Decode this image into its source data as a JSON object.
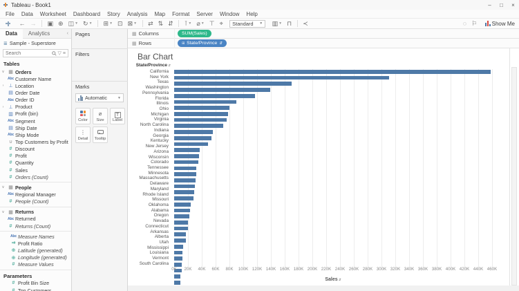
{
  "window": {
    "title": "Tableau - Book1",
    "controls": {
      "minimize": "–",
      "maximize": "□",
      "close": "×"
    }
  },
  "menu": {
    "items": [
      "File",
      "Data",
      "Worksheet",
      "Dashboard",
      "Story",
      "Analysis",
      "Map",
      "Format",
      "Server",
      "Window",
      "Help"
    ]
  },
  "toolbar": {
    "left_icons": [
      {
        "name": "undo-icon",
        "glyph": "←"
      },
      {
        "name": "redo-icon",
        "glyph": "→",
        "disabled": true
      },
      {
        "sep": true
      },
      {
        "name": "save-icon",
        "glyph": "▣"
      },
      {
        "name": "add-data-icon",
        "glyph": "⊕"
      },
      {
        "name": "pause-updates-icon",
        "glyph": "◫",
        "caret": true
      },
      {
        "name": "run-update-icon",
        "glyph": "↻",
        "caret": true
      },
      {
        "sep": true
      },
      {
        "name": "new-worksheet-icon",
        "glyph": "⊞",
        "caret": true
      },
      {
        "name": "duplicate-sheet-icon",
        "glyph": "⊡"
      },
      {
        "name": "clear-sheet-icon",
        "glyph": "⊠",
        "caret": true
      },
      {
        "sep": true
      },
      {
        "name": "swap-axes-icon",
        "glyph": "⇄"
      },
      {
        "name": "sort-ascending-icon",
        "glyph": "⇅"
      },
      {
        "name": "sort-descending-icon",
        "glyph": "⇵"
      },
      {
        "sep": true
      },
      {
        "name": "mark-labels-icon",
        "glyph": "⊺",
        "caret": true
      },
      {
        "name": "fix-axes-icon",
        "glyph": "⌀",
        "caret": true
      },
      {
        "name": "text-table-icon",
        "glyph": "⊤"
      },
      {
        "name": "drop-lines-icon",
        "glyph": "⌖"
      }
    ],
    "fit_label": "Standard",
    "after_fit_icons": [
      {
        "name": "show-cards-icon",
        "glyph": "▥",
        "caret": true
      },
      {
        "name": "presentation-mode-icon",
        "glyph": "⊓"
      },
      {
        "sep": true
      },
      {
        "name": "share-icon",
        "glyph": "≺"
      }
    ],
    "right_icons": [
      {
        "name": "data-details-icon",
        "glyph": "◌"
      },
      {
        "name": "flag-icon",
        "glyph": "⚐"
      }
    ],
    "show_me_label": "Show Me"
  },
  "data_pane": {
    "tabs": [
      {
        "label": "Data",
        "active": true
      },
      {
        "label": "Analytics",
        "active": false
      }
    ],
    "collapse_glyph": "‹",
    "datasource": "Sample - Superstore",
    "search": {
      "placeholder": "Search"
    },
    "tables_header": "Tables",
    "parameters_header": "Parameters",
    "items": [
      {
        "label": "Orders",
        "icon": "table",
        "header": true,
        "expanded": true
      },
      {
        "label": "Customer Name",
        "icon": "abc"
      },
      {
        "label": "Location",
        "icon": "hierarchy",
        "expandable": true
      },
      {
        "label": "Order Date",
        "icon": "calendar"
      },
      {
        "label": "Order ID",
        "icon": "abc"
      },
      {
        "label": "Product",
        "icon": "hierarchy",
        "expandable": true
      },
      {
        "label": "Profit (bin)",
        "icon": "bin"
      },
      {
        "label": "Segment",
        "icon": "abc"
      },
      {
        "label": "Ship Date",
        "icon": "calendar"
      },
      {
        "label": "Ship Mode",
        "icon": "abc"
      },
      {
        "label": "Top Customers by Profit",
        "icon": "set"
      },
      {
        "label": "Discount",
        "icon": "measure"
      },
      {
        "label": "Profit",
        "icon": "measure"
      },
      {
        "label": "Quantity",
        "icon": "measure"
      },
      {
        "label": "Sales",
        "icon": "measure"
      },
      {
        "label": "Orders (Count)",
        "icon": "measure",
        "italic": true
      },
      {
        "divider": true
      },
      {
        "label": "People",
        "icon": "table",
        "header": true,
        "expanded": true
      },
      {
        "label": "Regional Manager",
        "icon": "abc"
      },
      {
        "label": "People (Count)",
        "icon": "measure",
        "italic": true
      },
      {
        "divider": true
      },
      {
        "label": "Returns",
        "icon": "table",
        "header": true,
        "expanded": true
      },
      {
        "label": "Returned",
        "icon": "abc"
      },
      {
        "label": "Returns (Count)",
        "icon": "measure",
        "italic": true
      },
      {
        "divider": true
      },
      {
        "label": "Measure Names",
        "icon": "abc",
        "italic": true,
        "loose": true
      },
      {
        "label": "Profit Ratio",
        "icon": "calc",
        "loose": true
      },
      {
        "label": "Latitude (generated)",
        "icon": "geo",
        "italic": true,
        "loose": true
      },
      {
        "label": "Longitude (generated)",
        "icon": "geo",
        "italic": true,
        "loose": true
      },
      {
        "label": "Measure Values",
        "icon": "measure",
        "italic": true,
        "loose": true
      },
      {
        "divider": true
      },
      {
        "param_header": true
      },
      {
        "label": "Profit Bin Size",
        "icon": "measure",
        "loose": true
      },
      {
        "label": "Top Customers",
        "icon": "measure",
        "loose": true
      }
    ]
  },
  "cards": {
    "pages_label": "Pages",
    "filters_label": "Filters",
    "marks_label": "Marks",
    "mark_type_label": "Automatic",
    "buttons": [
      {
        "label": "Color",
        "icon": "color-swatches"
      },
      {
        "label": "Size",
        "icon": "size"
      },
      {
        "label": "Label",
        "icon": "text-label"
      },
      {
        "label": "Detail",
        "icon": "detail"
      },
      {
        "label": "Tooltip",
        "icon": "tooltip"
      }
    ]
  },
  "shelves": {
    "columns_label": "Columns",
    "rows_label": "Rows",
    "columns_pills": [
      {
        "label": "SUM(Sales)",
        "type": "measure"
      }
    ],
    "rows_pills": [
      {
        "label": "State/Province",
        "type": "dimension",
        "sorted": true
      }
    ]
  },
  "sheet": {
    "title": "Bar Chart"
  },
  "chart_data": {
    "type": "bar",
    "orientation": "horizontal",
    "title": "Bar Chart",
    "row_header": "State/Province",
    "xlabel": "Sales",
    "value_unit": "USD, thousands (K)",
    "xlim": [
      0,
      460
    ],
    "tick_step_k": 20,
    "tick_labels": [
      "0K",
      "20K",
      "40K",
      "60K",
      "80K",
      "100K",
      "120K",
      "140K",
      "160K",
      "180K",
      "200K",
      "220K",
      "240K",
      "260K",
      "280K",
      "300K",
      "320K",
      "340K",
      "360K",
      "380K",
      "400K",
      "420K",
      "440K",
      "460K"
    ],
    "grid": true,
    "sort": "descending by SUM(Sales)",
    "bar_color": "#4e79a7",
    "categories": [
      "California",
      "New York",
      "Texas",
      "Washington",
      "Pennsylvania",
      "Florida",
      "Illinois",
      "Ohio",
      "Michigan",
      "Virginia",
      "North Carolina",
      "Indiana",
      "Georgia",
      "Kentucky",
      "New Jersey",
      "Arizona",
      "Wisconsin",
      "Colorado",
      "Tennessee",
      "Minnesota",
      "Massachusetts",
      "Delaware",
      "Maryland",
      "Rhode Island",
      "Missouri",
      "Oklahoma",
      "Alabama",
      "Oregon",
      "Nevada",
      "Connecticut",
      "Arkansas",
      "Alberta",
      "Utah",
      "Mississippi",
      "Louisiana",
      "Vermont",
      "South Carolina"
    ],
    "values_k": [
      457.7,
      310.9,
      170.2,
      138.6,
      116.5,
      89.5,
      80.2,
      78.3,
      76.3,
      70.6,
      55.6,
      53.6,
      49.1,
      36.6,
      35.8,
      35.3,
      32.1,
      32.1,
      30.7,
      29.9,
      28.6,
      27.5,
      23.7,
      22.6,
      22.2,
      19.7,
      19.5,
      17.4,
      16.7,
      13.4,
      11.7,
      11.6,
      11.2,
      10.8,
      9.2,
      8.9,
      8.5
    ]
  },
  "colors": {
    "bar_blue": "#4e79a7",
    "pill_green": "#2eb88a",
    "pill_blue": "#4a84c4",
    "dimension_blue": "#4e79b7",
    "measure_green": "#35a08c"
  }
}
